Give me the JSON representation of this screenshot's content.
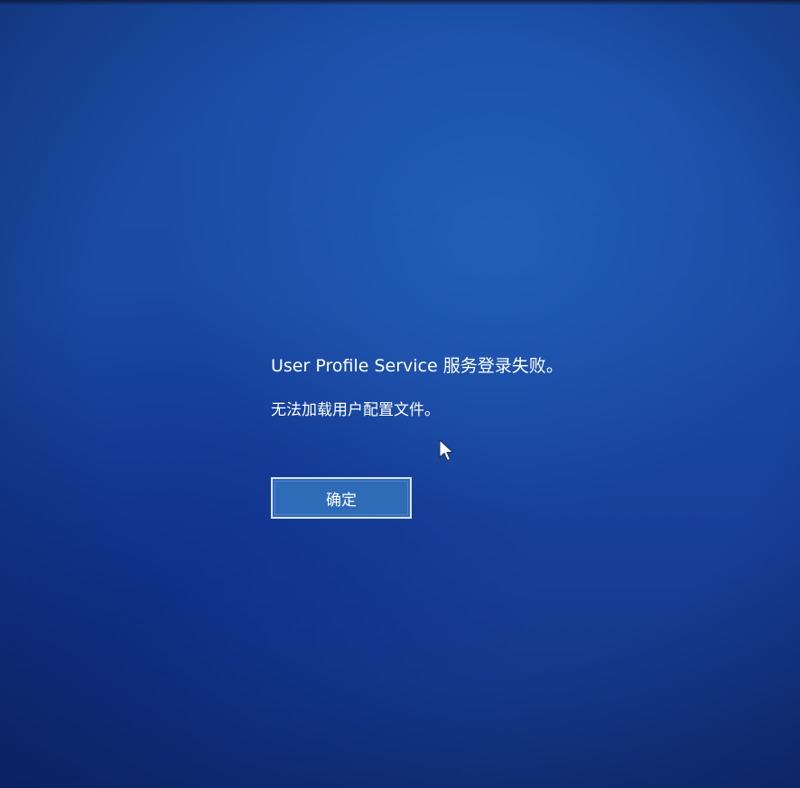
{
  "dialog": {
    "title": "User Profile Service 服务登录失败。",
    "detail": "无法加载用户配置文件。",
    "ok_label": "确定"
  },
  "icons": {
    "cursor": "mouse-pointer-icon"
  },
  "colors": {
    "background": "#1a4aa3",
    "button_fill": "#2f6cb8",
    "button_border": "#d9e4f4",
    "text": "#ffffff"
  }
}
